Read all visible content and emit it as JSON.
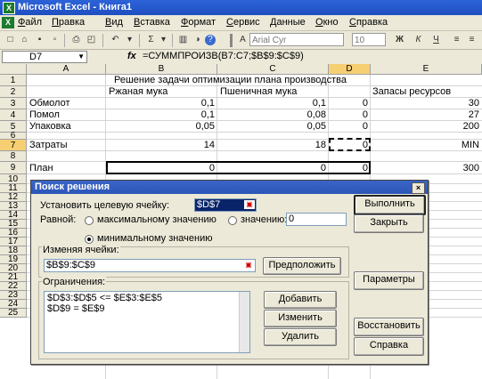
{
  "window": {
    "title": "Microsoft Excel - Книга1",
    "app_icon": "X"
  },
  "menu": [
    "Файл",
    "Правка",
    "Вид",
    "Вставка",
    "Формат",
    "Сервис",
    "Данные",
    "Окно",
    "Справка"
  ],
  "toolbar": {
    "font": "Arial Cyr",
    "size": "10",
    "bold": "Ж",
    "italic": "К",
    "underline": "Ч",
    "sigma": "Σ",
    "zoom_icon_label": "?"
  },
  "formula_bar": {
    "name_box": "D7",
    "fx": "fx",
    "formula": "=СУММПРОИЗВ(B7:C7;$B$9:$C$9)"
  },
  "columns": [
    "A",
    "B",
    "C",
    "D",
    "E"
  ],
  "rows": [
    "1",
    "2",
    "3",
    "4",
    "5",
    "6",
    "7",
    "8",
    "9",
    "10",
    "11",
    "12",
    "13",
    "14",
    "15",
    "16",
    "17",
    "18",
    "19",
    "20",
    "21",
    "22",
    "23",
    "24",
    "25"
  ],
  "sheet": {
    "title": "Решение задачи оптимизации плана производства",
    "headers": {
      "b": "Ржаная мука",
      "c": "Пшеничная мука",
      "e": "Запасы ресурсов"
    },
    "r3": {
      "a": "Обмолот",
      "b": "0,1",
      "c": "0,1",
      "d": "0",
      "e": "30"
    },
    "r4": {
      "a": "Помол",
      "b": "0,1",
      "c": "0,08",
      "d": "0",
      "e": "27"
    },
    "r5": {
      "a": "Упаковка",
      "b": "0,05",
      "c": "0,05",
      "d": "0",
      "e": "200"
    },
    "r7": {
      "a": "Затраты",
      "b": "14",
      "c": "18",
      "d": "0",
      "e": "MIN"
    },
    "r9": {
      "a": "План",
      "b": "0",
      "c": "0",
      "d": "0",
      "e": "300"
    }
  },
  "dialog": {
    "title": "Поиск решения",
    "target_label": "Установить целевую ячейку:",
    "target_value": "$D$7",
    "equal_label": "Равной:",
    "opt_max": "максимальному значению",
    "opt_value": "значению:",
    "value_field": "0",
    "opt_min": "минимальному значению",
    "changing_label": "Изменяя ячейки:",
    "changing_value": "$B$9:$C$9",
    "guess_button": "Предположить",
    "constraints_label": "Ограничения:",
    "constraints": [
      "$D$3:$D$5 <= $E$3:$E$5",
      "$D$9 = $E$9"
    ],
    "add_button": "Добавить",
    "change_button": "Изменить",
    "delete_button": "Удалить",
    "solve_button": "Выполнить",
    "close_button": "Закрыть",
    "options_button": "Параметры",
    "reset_button": "Восстановить",
    "help_button": "Справка",
    "close_x": "×",
    "ref_icon": "▣"
  }
}
